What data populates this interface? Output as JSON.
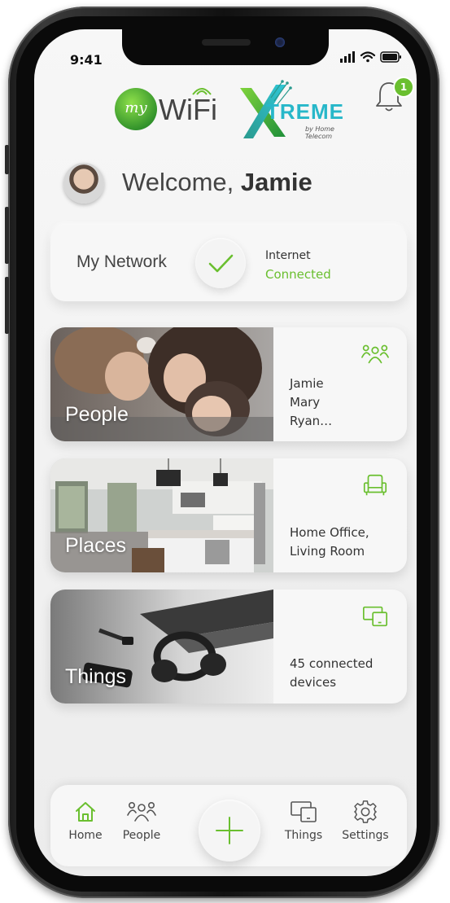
{
  "status": {
    "time": "9:41"
  },
  "logo": {
    "my": "my",
    "wifi": "WiFi",
    "treme": "TREME",
    "by": "by Home Telecom"
  },
  "notifications": {
    "count": "1"
  },
  "welcome": {
    "greeting": "Welcome,",
    "name": "Jamie"
  },
  "network": {
    "title": "My Network",
    "label": "Internet",
    "status": "Connected"
  },
  "cards": {
    "people": {
      "title": "People",
      "lines": [
        "Jamie",
        "Mary",
        "Ryan…"
      ]
    },
    "places": {
      "title": "Places",
      "lines": [
        "Home Office,",
        "Living Room"
      ]
    },
    "things": {
      "title": "Things",
      "lines": [
        "45 connected",
        "devices"
      ]
    }
  },
  "nav": {
    "home": "Home",
    "people": "People",
    "things": "Things",
    "settings": "Settings"
  },
  "colors": {
    "accent": "#6abf2f",
    "brand_teal": "#27b7c9"
  },
  "icons": {
    "bell": "bell-icon",
    "check": "check-icon",
    "people": "people-icon",
    "places": "armchair-icon",
    "things": "devices-icon",
    "home": "home-icon",
    "add": "plus-icon",
    "settings": "gear-icon"
  }
}
